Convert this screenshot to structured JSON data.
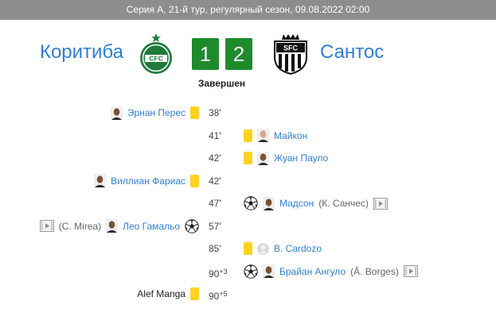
{
  "header": {
    "title": "Серия А, 21-й тур, регулярный сезон, 09.08.2022 02:00"
  },
  "home": {
    "name": "Коритиба",
    "score": "1"
  },
  "away": {
    "name": "Сантос",
    "score": "2"
  },
  "status": "Завершен",
  "colors": {
    "accent": "#2f7fd8",
    "score_bg": "#1e8a2c",
    "yellow_card": "#ffd21f",
    "topbar": "#8d8d8d"
  },
  "events": [
    {
      "side": "home",
      "minute": "38'",
      "minute_extra": "",
      "type": "yellow_card",
      "player": "Эрнан Перес",
      "avatar": "dark"
    },
    {
      "side": "away",
      "minute": "41'",
      "minute_extra": "",
      "type": "yellow_card",
      "player": "Майкон",
      "avatar": "light"
    },
    {
      "side": "away",
      "minute": "42'",
      "minute_extra": "",
      "type": "yellow_card",
      "player": "Жуан Пауло",
      "avatar": "dark"
    },
    {
      "side": "home",
      "minute": "42'",
      "minute_extra": "",
      "type": "yellow_card",
      "player": "Виллиан Фариас",
      "avatar": "dark"
    },
    {
      "side": "away",
      "minute": "47'",
      "minute_extra": "",
      "type": "goal",
      "player": "Мадсон",
      "assist": "(К. Санчес)",
      "avatar": "dark",
      "video": true
    },
    {
      "side": "home",
      "minute": "57'",
      "minute_extra": "",
      "type": "goal",
      "player": "Лео Гамальо",
      "assist": "(C. Mirea)",
      "avatar": "dark",
      "video": true
    },
    {
      "side": "away",
      "minute": "85'",
      "minute_extra": "",
      "type": "yellow_card",
      "player": "B. Cardozo",
      "avatar": "placeholder"
    },
    {
      "side": "away",
      "minute": "90",
      "minute_extra": "+3",
      "type": "goal",
      "player": "Брайан Ангуло",
      "assist": "(Â. Borges)",
      "avatar": "dark",
      "video": true
    },
    {
      "side": "home",
      "minute": "90",
      "minute_extra": "+5",
      "type": "yellow_card",
      "player": "Alef Manga",
      "avatar": "none",
      "plain": true
    }
  ]
}
